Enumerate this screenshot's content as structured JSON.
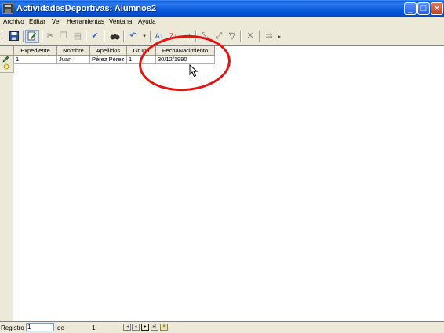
{
  "window": {
    "title": "ActividadesDeportivas: Alumnos2"
  },
  "menu": [
    "Archivo",
    "Editar",
    "Ver",
    "Herramientas",
    "Ventana",
    "Ayuda"
  ],
  "toolbar": {
    "buttons": [
      "save-icon",
      "edit-icon",
      "cut-icon",
      "copy-icon",
      "paste-icon",
      "spellcheck-icon",
      "find-icon",
      "undo-icon",
      "sort-asc-icon",
      "sort-desc-icon",
      "autofilter-icon",
      "filter-icon",
      "remove-filter-icon",
      "data-to-text-icon"
    ]
  },
  "table": {
    "columns": [
      "Expediente",
      "Nombre",
      "Apellidos",
      "Grupo",
      "FechaNacimiento"
    ],
    "rows": [
      [
        "1",
        "Juan",
        "Pérez Pérez",
        "1",
        "30/12/1990"
      ]
    ]
  },
  "status": {
    "registro_label": "Registro",
    "registro_value": "1",
    "de_label": "de",
    "total": "1"
  },
  "colors": {
    "annotation": "#e21414",
    "title_bar": "#0758da"
  }
}
